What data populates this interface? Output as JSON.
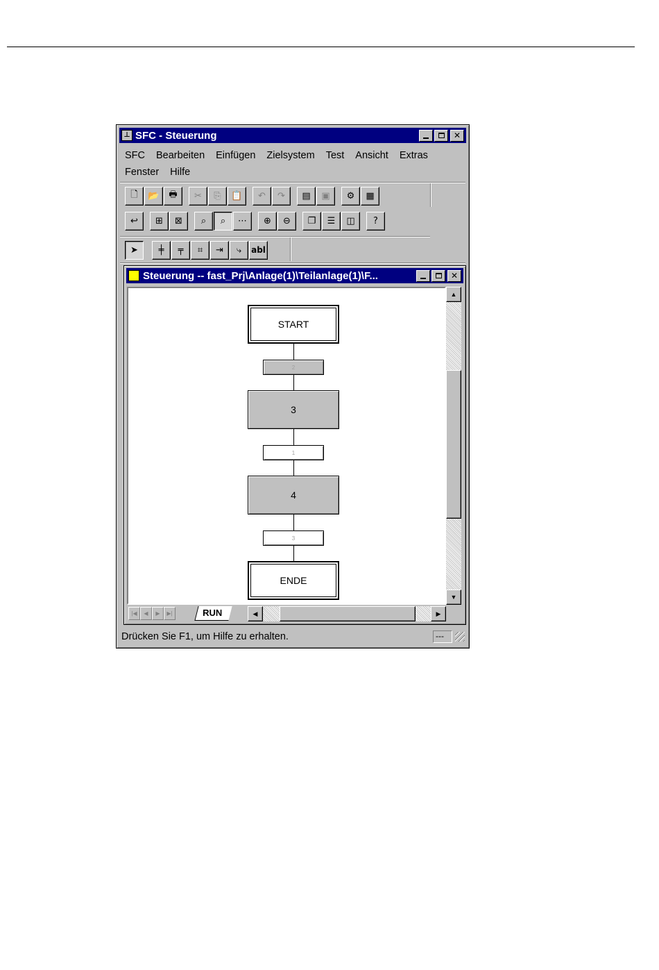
{
  "window": {
    "title": "SFC - Steuerung"
  },
  "menu": {
    "row1": [
      "SFC",
      "Bearbeiten",
      "Einfügen",
      "Zielsystem",
      "Test",
      "Ansicht",
      "Extras"
    ],
    "row2": [
      "Fenster",
      "Hilfe"
    ]
  },
  "toolbar": {
    "row1": [
      {
        "name": "new-icon",
        "glyph": "🗋"
      },
      {
        "name": "open-icon",
        "glyph": "📂"
      },
      {
        "name": "print-icon",
        "glyph": "🖶"
      },
      {
        "name": "cut-icon",
        "glyph": "✂",
        "disabled": true
      },
      {
        "name": "copy-icon",
        "glyph": "⎘",
        "disabled": true
      },
      {
        "name": "paste-icon",
        "glyph": "📋"
      },
      {
        "name": "undo-icon",
        "glyph": "↶",
        "disabled": true
      },
      {
        "name": "redo-icon",
        "glyph": "↷",
        "disabled": true
      },
      {
        "name": "properties-icon",
        "glyph": "▤"
      },
      {
        "name": "object-properties-icon",
        "glyph": "▣",
        "disabled": true
      },
      {
        "name": "compile-icon",
        "glyph": "⚙"
      },
      {
        "name": "download-icon",
        "glyph": "▦"
      }
    ],
    "row2": [
      {
        "name": "back-icon",
        "glyph": "↩"
      },
      {
        "name": "tree-icon",
        "glyph": "⊞"
      },
      {
        "name": "network-icon",
        "glyph": "⊠"
      },
      {
        "name": "overview-icon",
        "glyph": "⌕"
      },
      {
        "name": "test-mode-icon",
        "glyph": "⌕"
      },
      {
        "name": "monitor-icon",
        "glyph": "⋯"
      },
      {
        "name": "zoom-in-icon",
        "glyph": "⊕"
      },
      {
        "name": "zoom-out-icon",
        "glyph": "⊖"
      },
      {
        "name": "cascade-icon",
        "glyph": "❐"
      },
      {
        "name": "tile-horizontal-icon",
        "glyph": "☰"
      },
      {
        "name": "tile-vertical-icon",
        "glyph": "◫"
      },
      {
        "name": "context-help-icon",
        "glyph": "?"
      }
    ],
    "row3": [
      {
        "name": "select-pointer-icon",
        "glyph": "➤"
      },
      {
        "name": "step-transition-icon",
        "glyph": "╪"
      },
      {
        "name": "alternative-branch-icon",
        "glyph": "╤"
      },
      {
        "name": "simultaneous-branch-icon",
        "glyph": "⌗"
      },
      {
        "name": "jump-icon",
        "glyph": "⇥"
      },
      {
        "name": "loop-icon",
        "glyph": "⤷"
      },
      {
        "name": "text-field-icon",
        "glyph": "abl"
      }
    ]
  },
  "document": {
    "title": "Steuerung -- fast_Prj\\Anlage(1)\\Teilanlage(1)\\F...",
    "sheet_tab": "RUN"
  },
  "sfc": {
    "steps": [
      {
        "label": "START",
        "kind": "initial"
      },
      {
        "label": "3",
        "kind": "normal"
      },
      {
        "label": "4",
        "kind": "normal"
      },
      {
        "label": "ENDE",
        "kind": "initial"
      }
    ],
    "transitions": [
      {
        "label": "2",
        "fill": "grey"
      },
      {
        "label": "1",
        "fill": "white"
      },
      {
        "label": "3",
        "fill": "white"
      }
    ]
  },
  "status": {
    "text": "Drücken Sie F1, um Hilfe zu erhalten.",
    "pane": "---"
  }
}
